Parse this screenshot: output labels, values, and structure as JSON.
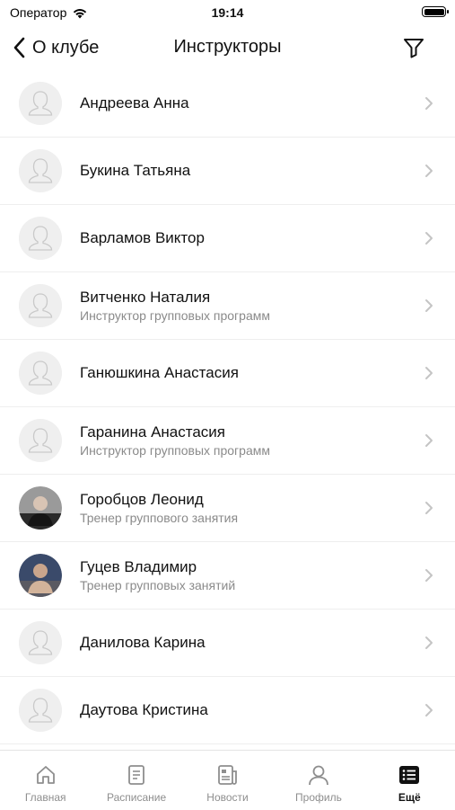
{
  "status": {
    "carrier": "Оператор",
    "time": "19:14"
  },
  "nav": {
    "back_label": "О клубе",
    "title": "Инструкторы",
    "filter_icon": "filter-icon"
  },
  "instructors": [
    {
      "name": "Андреева Анна",
      "subtitle": "",
      "avatar": "placeholder"
    },
    {
      "name": "Букина Татьяна",
      "subtitle": "",
      "avatar": "placeholder"
    },
    {
      "name": "Варламов Виктор",
      "subtitle": "",
      "avatar": "placeholder"
    },
    {
      "name": "Витченко Наталия",
      "subtitle": "Инструктор групповых программ",
      "avatar": "placeholder"
    },
    {
      "name": "Ганюшкина Анастасия",
      "subtitle": "",
      "avatar": "placeholder"
    },
    {
      "name": "Гаранина Анастасия",
      "subtitle": "Инструктор групповых программ",
      "avatar": "placeholder"
    },
    {
      "name": "Горобцов Леонид",
      "subtitle": "Тренер группового занятия",
      "avatar": "photo"
    },
    {
      "name": "Гуцев Владимир",
      "subtitle": "Тренер групповых занятий",
      "avatar": "photo"
    },
    {
      "name": "Данилова Карина",
      "subtitle": "",
      "avatar": "placeholder"
    },
    {
      "name": "Даутова Кристина",
      "subtitle": "",
      "avatar": "placeholder"
    },
    {
      "name": "",
      "subtitle": "",
      "avatar": "placeholder"
    }
  ],
  "tabbar": {
    "items": [
      {
        "label": "Главная",
        "icon": "home-icon",
        "active": false
      },
      {
        "label": "Расписание",
        "icon": "schedule-icon",
        "active": false
      },
      {
        "label": "Новости",
        "icon": "news-icon",
        "active": false
      },
      {
        "label": "Профиль",
        "icon": "profile-icon",
        "active": false
      },
      {
        "label": "Ещё",
        "icon": "more-icon",
        "active": true
      }
    ]
  },
  "colors": {
    "text": "#111111",
    "subtitle": "#8a8a8a",
    "inactive_tab": "#8e8e8e",
    "divider": "#eeeeee"
  }
}
